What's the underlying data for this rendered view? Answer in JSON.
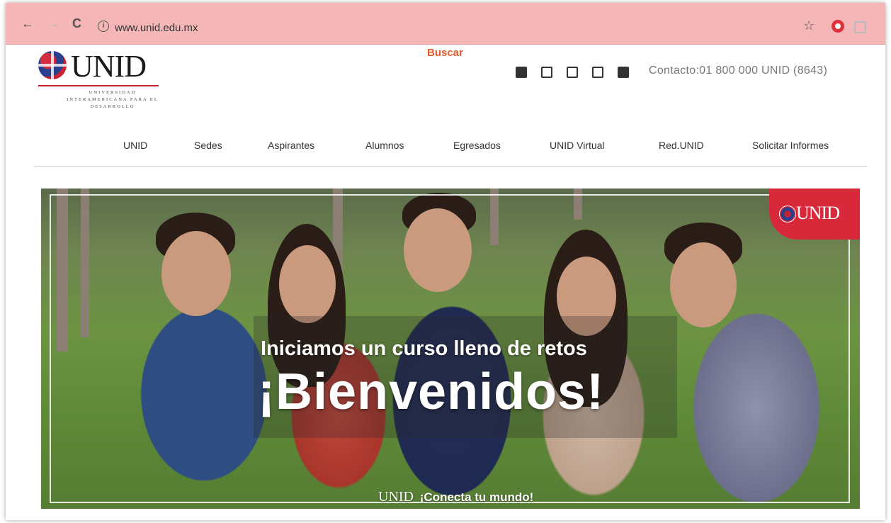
{
  "browser": {
    "back_icon": "←",
    "forward_icon": "→",
    "reload_icon": "C",
    "info_icon": "i",
    "url": "www.unid.edu.mx",
    "star_icon": "☆"
  },
  "header": {
    "logo_text": "UNID",
    "logo_subtitle": "UNIVERSIDAD INTERAMERICANA PARA EL DESARROLLO",
    "search_label": "Buscar",
    "social": [
      "facebook-icon",
      "twitter-icon",
      "youtube-icon",
      "instagram-icon",
      "linkedin-icon"
    ],
    "contact": "Contacto:01 800 000 UNID (8643)"
  },
  "menu": {
    "items": [
      "UNID",
      "Sedes",
      "Aspirantes",
      "Alumnos",
      "Egresados",
      "UNID Virtual",
      "Red.UNID",
      "Solicitar Informes"
    ]
  },
  "hero": {
    "badge_text": "UNID",
    "tagline": "Iniciamos un curso lleno de retos",
    "welcome": "¡Bienvenidos!",
    "slogan_brand": "UNID",
    "slogan": "¡Conecta tu mundo!"
  },
  "colors": {
    "brand_red": "#d8293a",
    "search_orange": "#e8592a",
    "browser_bar": "#f4b6b6"
  }
}
